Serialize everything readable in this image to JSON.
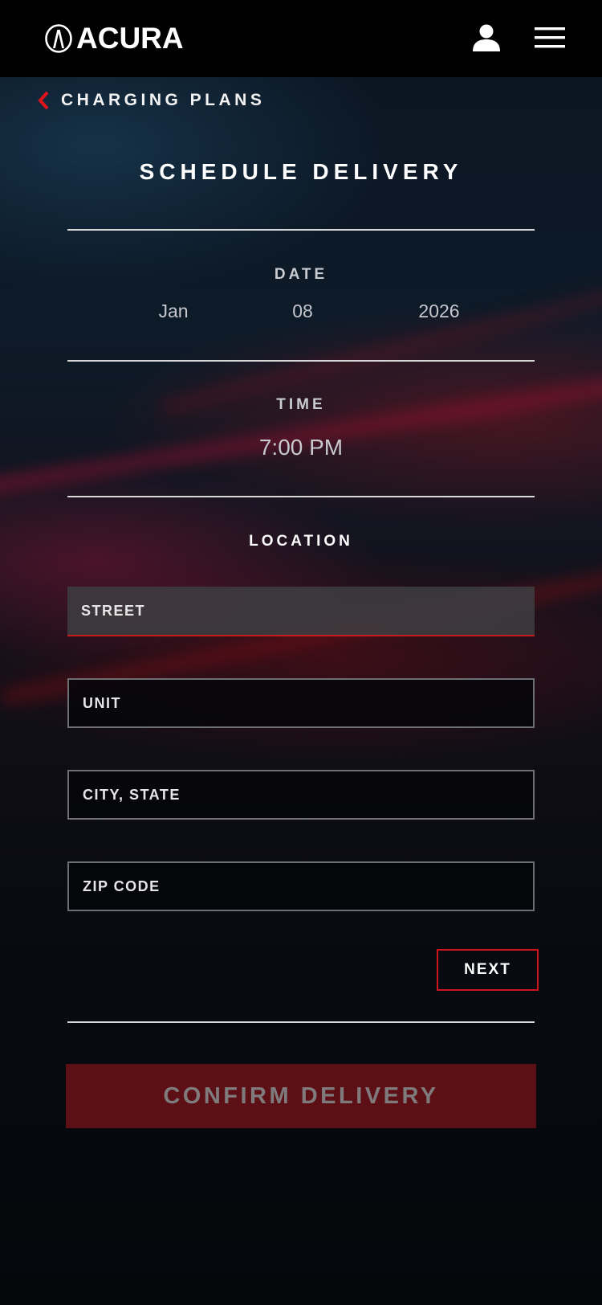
{
  "header": {
    "brand": "ACURA",
    "icons": {
      "logo": "acura-logo-icon",
      "user": "user-icon",
      "menu": "hamburger-menu-icon"
    }
  },
  "back_link": {
    "label": "CHARGING PLANS",
    "icon": "chevron-left-icon"
  },
  "title": "SCHEDULE DELIVERY",
  "date": {
    "label": "DATE",
    "month": "Jan",
    "day": "08",
    "year": "2026"
  },
  "time": {
    "label": "TIME",
    "value": "7:00 PM"
  },
  "location": {
    "label": "LOCATION",
    "fields": {
      "street": "STREET",
      "unit": "UNIT",
      "city_state": "CITY, STATE",
      "zip": "ZIP CODE"
    },
    "active_field": "street"
  },
  "buttons": {
    "next": "NEXT",
    "confirm": "CONFIRM DELIVERY"
  },
  "colors": {
    "accent": "#d0141b",
    "confirm_bg": "#5c1015",
    "background": "#05070b"
  }
}
